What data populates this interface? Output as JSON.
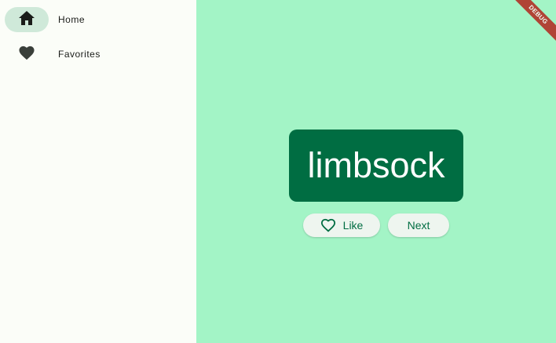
{
  "nav": {
    "items": [
      {
        "label": "Home",
        "icon": "home-icon",
        "selected": true
      },
      {
        "label": "Favorites",
        "icon": "heart-icon",
        "selected": false
      }
    ]
  },
  "main": {
    "word": "limbsock",
    "like_label": "Like",
    "next_label": "Next"
  },
  "debug_banner": "DEBUG",
  "colors": {
    "rail_bg": "#fbfdf8",
    "main_bg": "#a3f4c6",
    "card_bg": "#006d42",
    "indicator": "#cfe9d9",
    "button_bg": "#eef5ef",
    "button_text": "#006d42",
    "banner": "#b3261e"
  }
}
